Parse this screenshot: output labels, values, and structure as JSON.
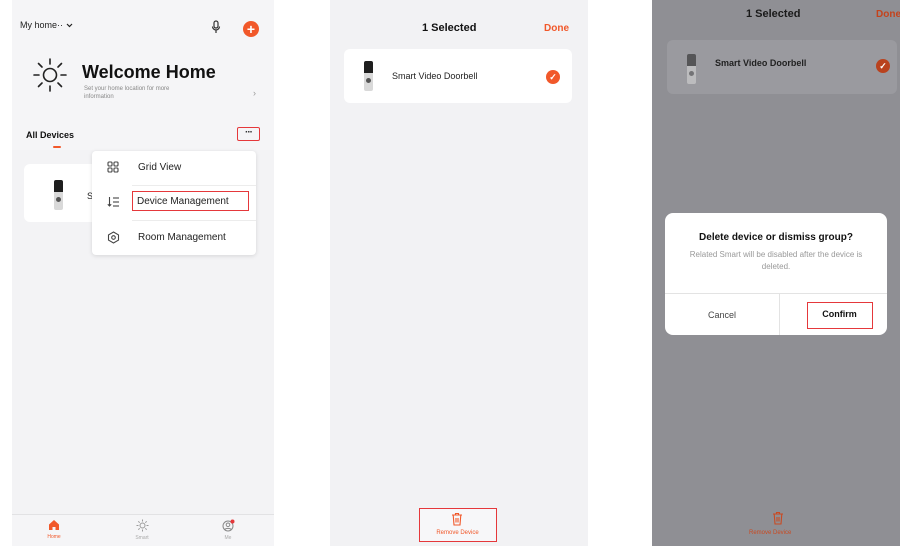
{
  "colors": {
    "accent": "#f1582a",
    "highlight": "#e5383b",
    "overlay": "#8f8f94"
  },
  "screen1": {
    "home_selector": "My home··",
    "welcome_title": "Welcome Home",
    "welcome_sub": "Set your home location for more information",
    "section_title": "All Devices",
    "more_icon": "···",
    "device_short_name": "Sm",
    "menu": {
      "items": [
        {
          "icon": "grid-icon",
          "label": "Grid View"
        },
        {
          "icon": "list-sort-icon",
          "label": "Device Management"
        },
        {
          "icon": "room-gear-icon",
          "label": "Room Management"
        }
      ]
    },
    "tabs": [
      {
        "icon": "home-icon",
        "label": "Home"
      },
      {
        "icon": "smart-sun-icon",
        "label": "Smart"
      },
      {
        "icon": "profile-icon",
        "label": "Me"
      }
    ]
  },
  "screen2": {
    "title": "1 Selected",
    "done": "Done",
    "device_name": "Smart Video Doorbell",
    "remove_label": "Remove Device"
  },
  "screen3": {
    "title": "1 Selected",
    "done": "Done",
    "device_name": "Smart Video Doorbell",
    "dialog": {
      "title": "Delete device or dismiss group?",
      "body": "Related Smart will be disabled after the device is deleted.",
      "cancel": "Cancel",
      "confirm": "Confirm"
    },
    "remove_label": "Remove Device"
  }
}
